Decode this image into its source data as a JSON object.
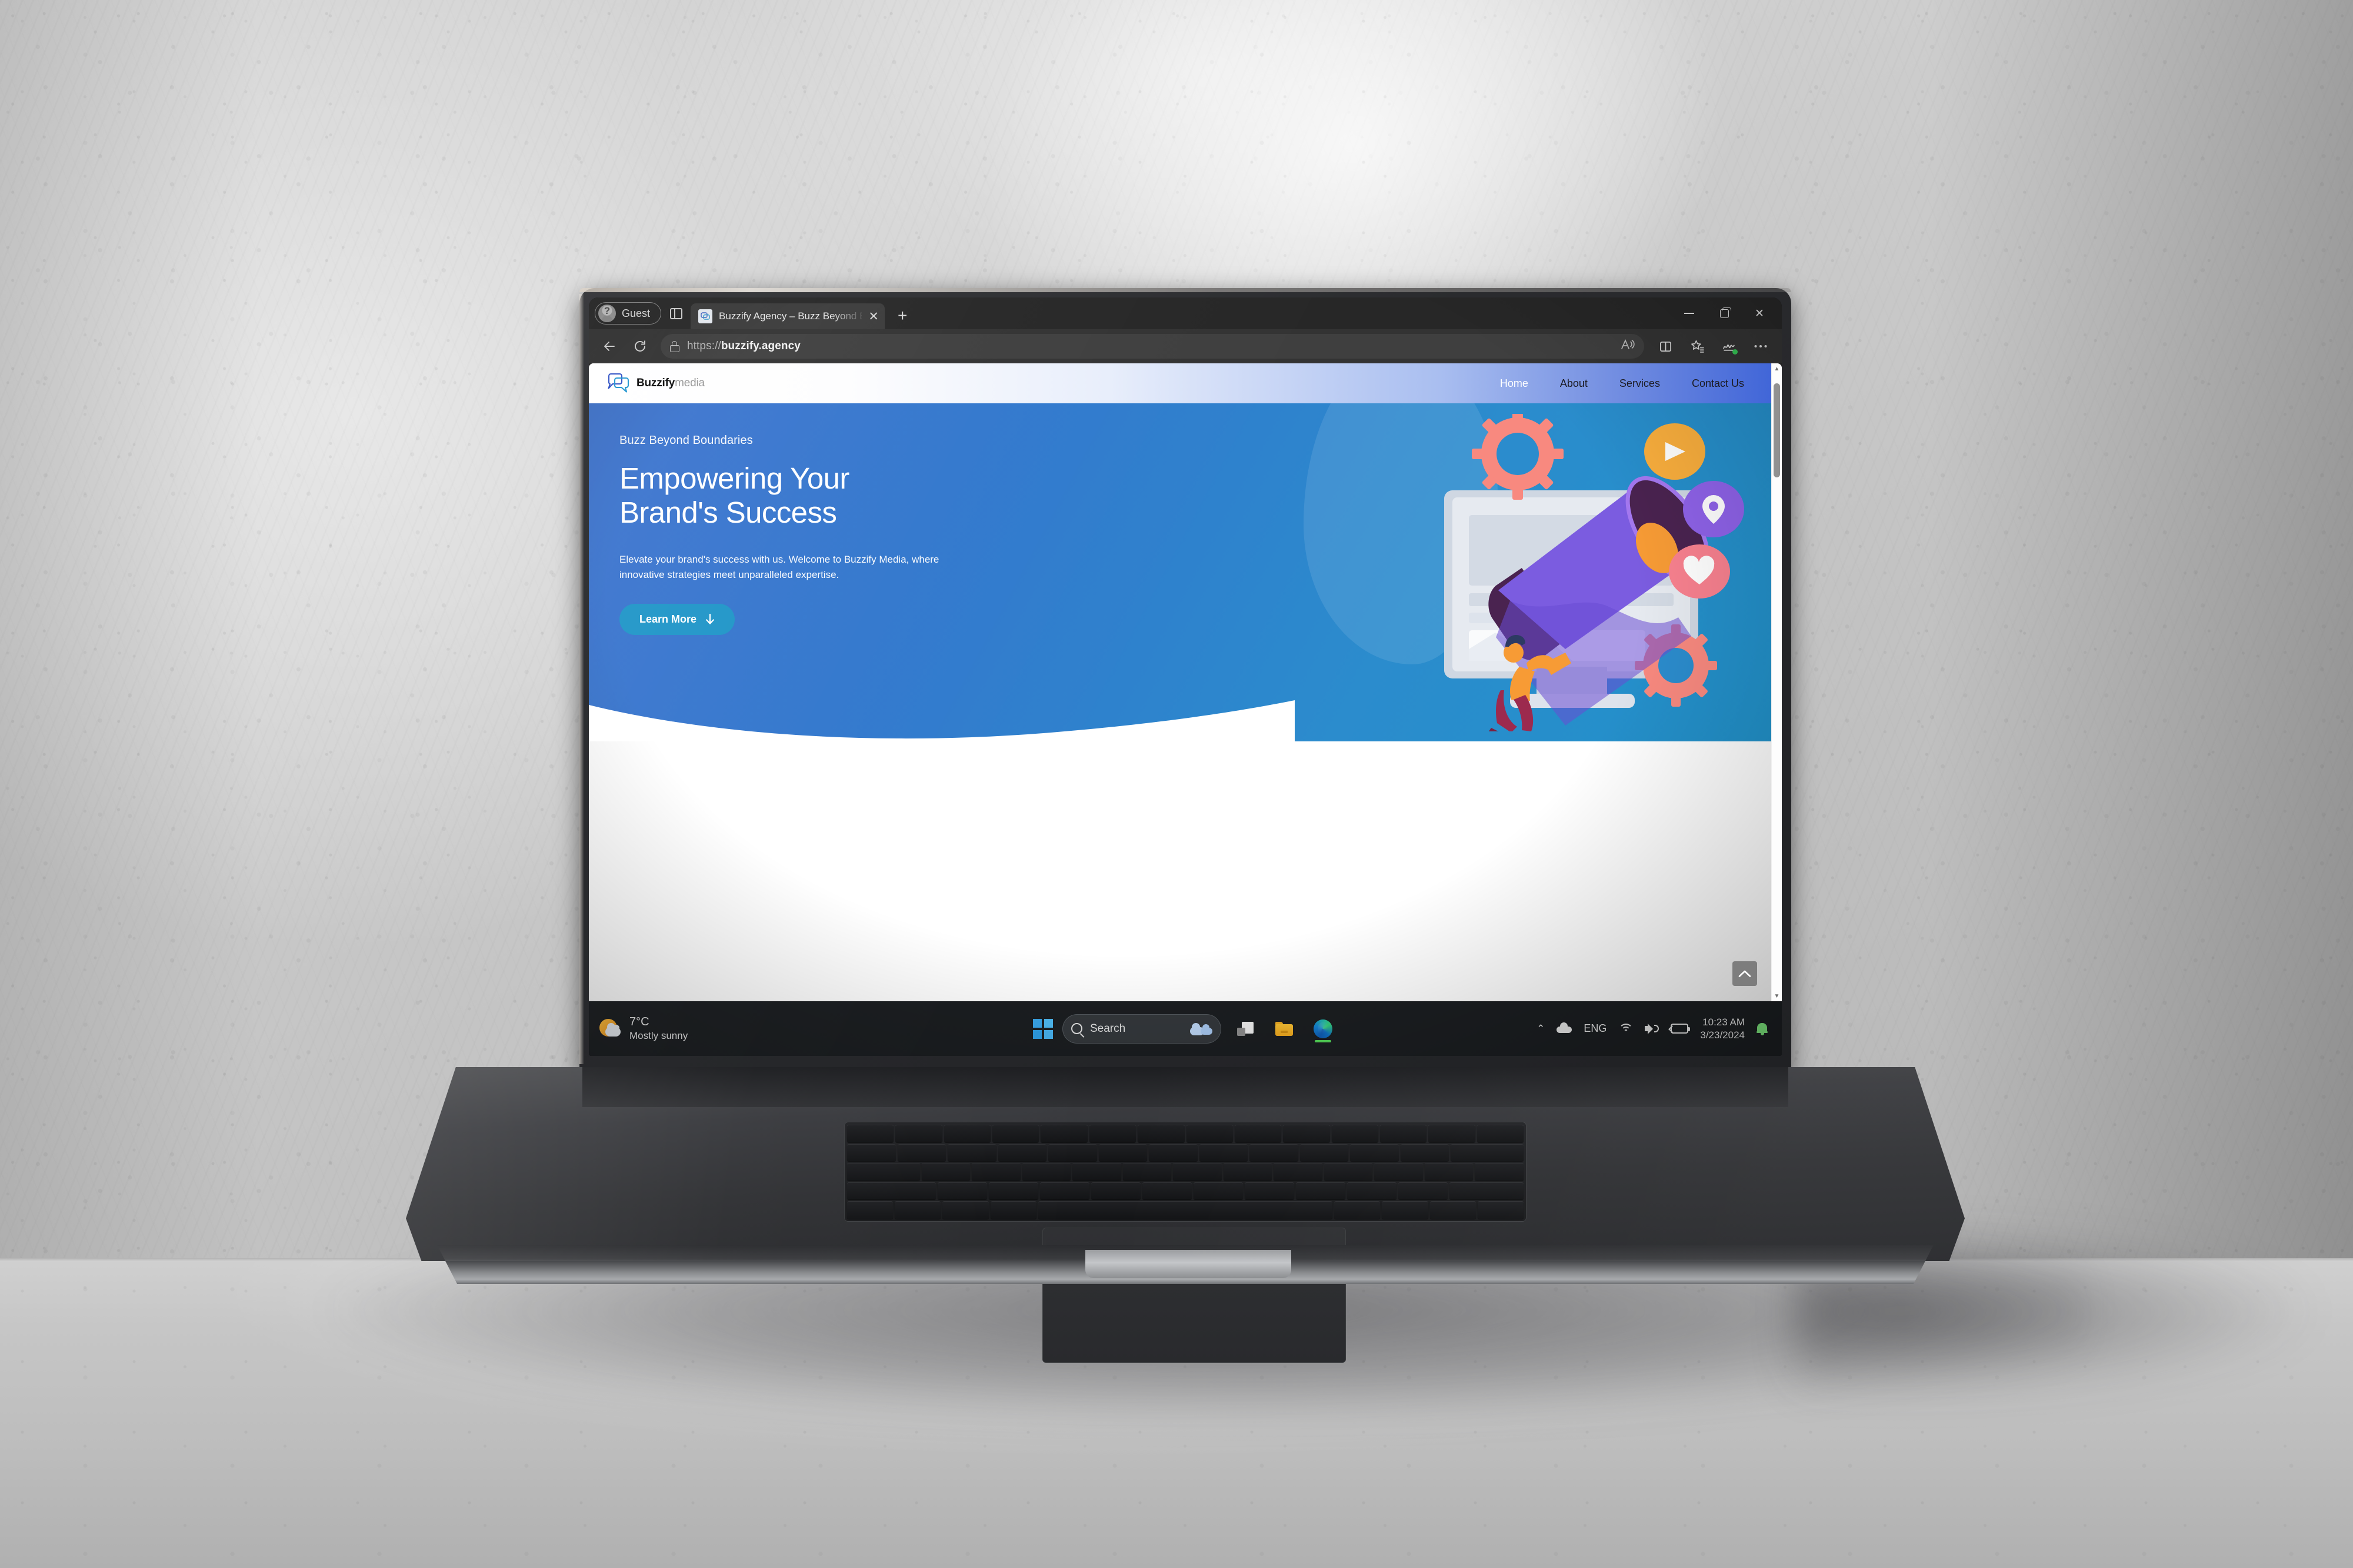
{
  "browser": {
    "profile_label": "Guest",
    "tab_list_icon": "tab-list-icon",
    "tabs": [
      {
        "title": "Buzzify Agency – Buzz Beyond Bo",
        "favicon": "buzzify-favicon",
        "close_icon": "close-icon"
      }
    ],
    "new_tab_label": "+",
    "window_controls": {
      "minimize": "minimize-icon",
      "restore": "restore-icon",
      "close": "✕"
    },
    "back_icon": "back-arrow-icon",
    "refresh_icon": "refresh-icon",
    "address": {
      "scheme": "https://",
      "domain": "buzzify.agency",
      "lock_icon": "lock-icon"
    },
    "toolbar_icons": [
      "read-aloud-icon",
      "split-screen-icon",
      "favorites-icon",
      "collections-icon",
      "settings-more-icon"
    ]
  },
  "site": {
    "logo": {
      "name_bold": "Buzzify",
      "name_light": "media",
      "icon": "speech-bubbles-icon"
    },
    "nav": [
      {
        "label": "Home",
        "active": true
      },
      {
        "label": "About",
        "active": false
      },
      {
        "label": "Services",
        "active": false
      },
      {
        "label": "Contact Us",
        "active": false
      }
    ],
    "hero": {
      "eyebrow": "Buzz Beyond Boundaries",
      "headline_line1": "Empowering Your",
      "headline_line2": "Brand's Success",
      "subcopy": "Elevate your brand's success with us. Welcome to Buzzify Media, where innovative strategies meet unparalleled expertise.",
      "cta_label": "Learn More",
      "cta_icon": "arrow-down-icon",
      "illustration": "megaphone-monitor-marketing-illustration"
    },
    "scroll_top_icon": "chevron-up-icon"
  },
  "taskbar": {
    "weather": {
      "temperature": "7°C",
      "condition": "Mostly sunny",
      "icon": "sun-cloud-icon"
    },
    "start_icon": "windows-logo-icon",
    "search": {
      "placeholder": "Search",
      "icon": "search-icon",
      "decoration": "clouds-icon"
    },
    "apps": [
      {
        "name": "task-view-icon"
      },
      {
        "name": "file-explorer-icon"
      },
      {
        "name": "microsoft-edge-icon",
        "active": true
      }
    ],
    "tray": {
      "overflow_icon": "chevron-up-icon",
      "onedrive_icon": "cloud-icon",
      "language": "ENG",
      "wifi_icon": "wifi-icon",
      "volume_icon": "volume-icon",
      "battery_icon": "battery-charging-icon",
      "time": "10:23 AM",
      "date": "3/23/2024",
      "notification_icon": "bell-icon"
    }
  },
  "colors": {
    "hero_blue_start": "#3f74cf",
    "hero_blue_end": "#2191c9",
    "cta_blue": "#2196c8",
    "header_gradient_end": "#4166d8",
    "taskbar_bg": "#1c1f22",
    "notification_green": "#7ee87e"
  }
}
